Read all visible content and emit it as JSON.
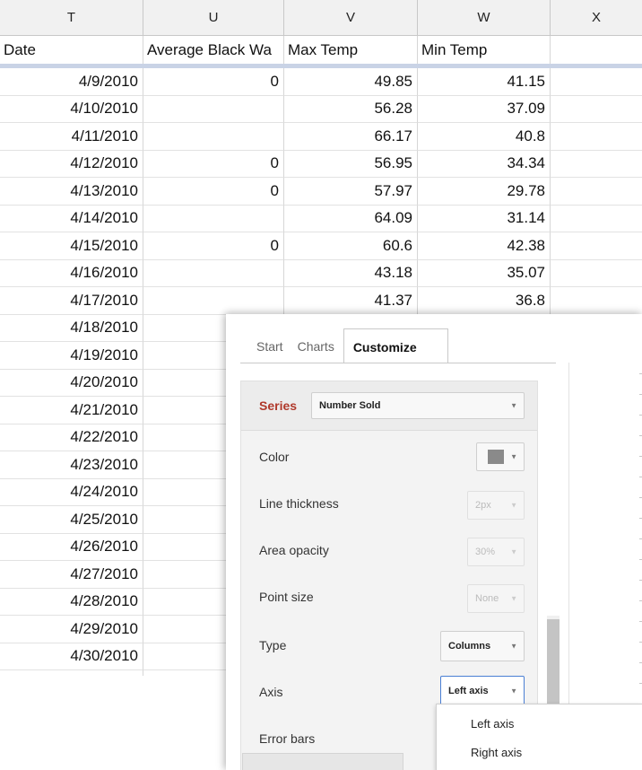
{
  "columns": [
    {
      "letter": "T",
      "header": "Date"
    },
    {
      "letter": "U",
      "header": "Average Black Wa"
    },
    {
      "letter": "V",
      "header": "Max Temp"
    },
    {
      "letter": "W",
      "header": "Min Temp"
    },
    {
      "letter": "X",
      "header": ""
    }
  ],
  "rows": [
    {
      "date": "4/9/2010",
      "avg": "0",
      "max": "49.85",
      "min": "41.15"
    },
    {
      "date": "4/10/2010",
      "avg": "",
      "max": "56.28",
      "min": "37.09"
    },
    {
      "date": "4/11/2010",
      "avg": "",
      "max": "66.17",
      "min": "40.8"
    },
    {
      "date": "4/12/2010",
      "avg": "0",
      "max": "56.95",
      "min": "34.34"
    },
    {
      "date": "4/13/2010",
      "avg": "0",
      "max": "57.97",
      "min": "29.78"
    },
    {
      "date": "4/14/2010",
      "avg": "",
      "max": "64.09",
      "min": "31.14"
    },
    {
      "date": "4/15/2010",
      "avg": "0",
      "max": "60.6",
      "min": "42.38"
    },
    {
      "date": "4/16/2010",
      "avg": "",
      "max": "43.18",
      "min": "35.07"
    },
    {
      "date": "4/17/2010",
      "avg": "",
      "max": "41.37",
      "min": "36.8"
    },
    {
      "date": "4/18/2010"
    },
    {
      "date": "4/19/2010"
    },
    {
      "date": "4/20/2010"
    },
    {
      "date": "4/21/2010"
    },
    {
      "date": "4/22/2010"
    },
    {
      "date": "4/23/2010"
    },
    {
      "date": "4/24/2010"
    },
    {
      "date": "4/25/2010"
    },
    {
      "date": "4/26/2010"
    },
    {
      "date": "4/27/2010"
    },
    {
      "date": "4/28/2010"
    },
    {
      "date": "4/29/2010"
    },
    {
      "date": "4/30/2010"
    }
  ],
  "editor": {
    "tabs": [
      "Start",
      "Charts",
      "Customize"
    ],
    "active_tab": "Customize",
    "series_label": "Series",
    "series_value": "Number Sold",
    "color_label": "Color",
    "color_value": "#8a8a8a",
    "line_thickness_label": "Line thickness",
    "line_thickness_value": "2px",
    "area_opacity_label": "Area opacity",
    "area_opacity_value": "30%",
    "point_size_label": "Point size",
    "point_size_value": "None",
    "type_label": "Type",
    "type_value": "Columns",
    "axis_label": "Axis",
    "axis_value": "Left axis",
    "error_bars_label": "Error bars",
    "axis_options": [
      "Left axis",
      "Right axis"
    ]
  },
  "colors": {
    "series_label": "#b0392b",
    "axis_select_border": "#4a7fd4",
    "freeze_bar": "#c9d3e6"
  }
}
